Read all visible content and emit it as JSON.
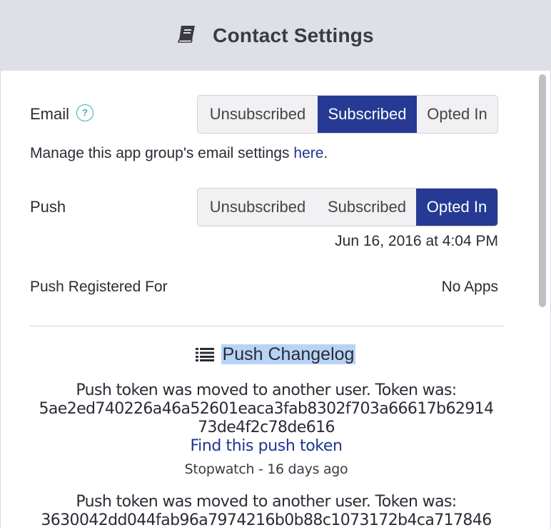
{
  "header": {
    "title": "Contact Settings",
    "icon": "book-icon"
  },
  "email": {
    "label": "Email",
    "help": "?",
    "options": [
      "Unsubscribed",
      "Subscribed",
      "Opted In"
    ],
    "selected": "Subscribed",
    "note_prefix": "Manage this app group's email settings ",
    "note_link": "here",
    "note_suffix": "."
  },
  "push": {
    "label": "Push",
    "options": [
      "Unsubscribed",
      "Subscribed",
      "Opted In"
    ],
    "selected": "Opted In",
    "date": "Jun 16, 2016 at 4:04 PM"
  },
  "registered": {
    "label": "Push Registered For",
    "value": "No Apps"
  },
  "changelog": {
    "title": "Push Changelog",
    "entries": [
      {
        "line1": "Push token was moved to another user. Token was:",
        "line2": "5ae2ed740226a46a52601eaca3fab8302f703a66617b62914",
        "line3": "73de4f2c78de616",
        "link": "Find this push token",
        "meta": "Stopwatch - 16 days ago"
      },
      {
        "line1": "Push token was moved to another user. Token was:",
        "line2": "3630042dd044fab96a7974216b0b88c1073172b4ca717846"
      }
    ]
  },
  "colors": {
    "accent": "#263a93",
    "link": "#1f3690",
    "help": "#38b2a6",
    "highlight": "#b7d4f6",
    "header_bg": "#dfe0e6"
  }
}
